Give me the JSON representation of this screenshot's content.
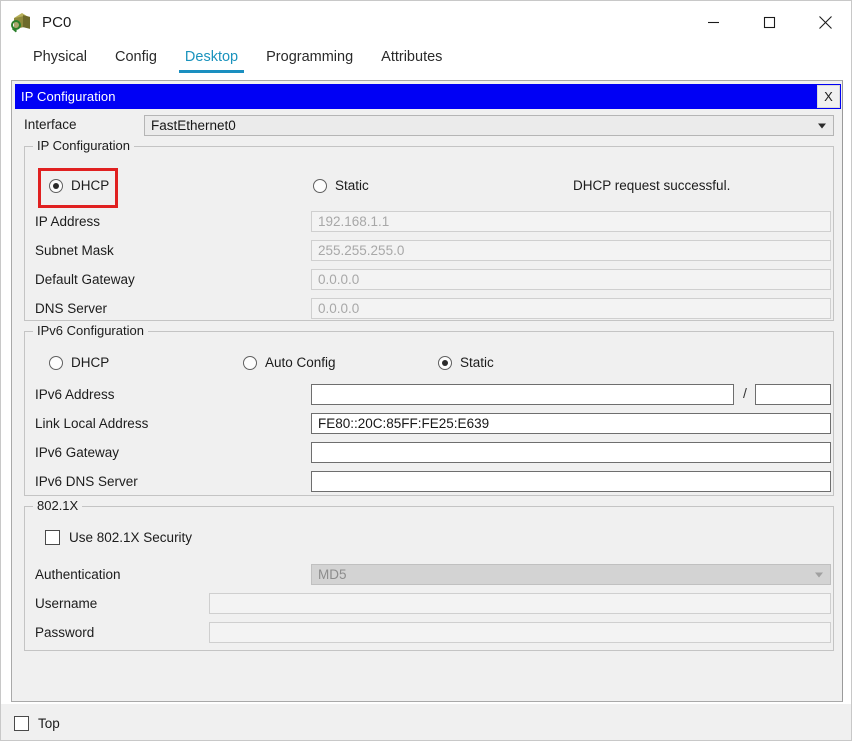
{
  "window": {
    "title": "PC0",
    "icon": "pc-device-icon",
    "controls": {
      "minimize": "minimize-icon",
      "maximize": "maximize-icon",
      "close": "close-icon"
    }
  },
  "tabs": [
    {
      "label": "Physical",
      "active": false
    },
    {
      "label": "Config",
      "active": false
    },
    {
      "label": "Desktop",
      "active": true
    },
    {
      "label": "Programming",
      "active": false
    },
    {
      "label": "Attributes",
      "active": false
    }
  ],
  "dialog": {
    "title": "IP Configuration",
    "close_label": "X"
  },
  "interface": {
    "label": "Interface",
    "value": "FastEthernet0"
  },
  "ipv4": {
    "legend": "IP Configuration",
    "dhcp_label": "DHCP",
    "static_label": "Static",
    "selected": "DHCP",
    "status": "DHCP request successful.",
    "fields": [
      {
        "label": "IP Address",
        "value": "192.168.1.1",
        "enabled": false
      },
      {
        "label": "Subnet Mask",
        "value": "255.255.255.0",
        "enabled": false
      },
      {
        "label": "Default Gateway",
        "value": "0.0.0.0",
        "enabled": false
      },
      {
        "label": "DNS Server",
        "value": "0.0.0.0",
        "enabled": false
      }
    ]
  },
  "ipv6": {
    "legend": "IPv6 Configuration",
    "dhcp_label": "DHCP",
    "autoconfig_label": "Auto Config",
    "static_label": "Static",
    "selected": "Static",
    "address_label": "IPv6 Address",
    "address_value": "",
    "prefix_value": "",
    "slash": "/",
    "fields": [
      {
        "label": "Link Local Address",
        "value": "FE80::20C:85FF:FE25:E639",
        "enabled": true
      },
      {
        "label": "IPv6 Gateway",
        "value": "",
        "enabled": true
      },
      {
        "label": "IPv6 DNS Server",
        "value": "",
        "enabled": true
      }
    ]
  },
  "dot1x": {
    "legend": "802.1X",
    "use_security_label": "Use 802.1X Security",
    "use_security_checked": false,
    "auth_label": "Authentication",
    "auth_value": "MD5",
    "fields": [
      {
        "label": "Username",
        "value": "",
        "enabled": false
      },
      {
        "label": "Password",
        "value": "",
        "enabled": false
      }
    ]
  },
  "bottom": {
    "top_label": "Top",
    "top_checked": false
  },
  "colors": {
    "dialog_header": "#0000f5",
    "active_tab": "#1a93bd",
    "highlight": "#e02020",
    "panel_bg": "#f0f0f0"
  }
}
